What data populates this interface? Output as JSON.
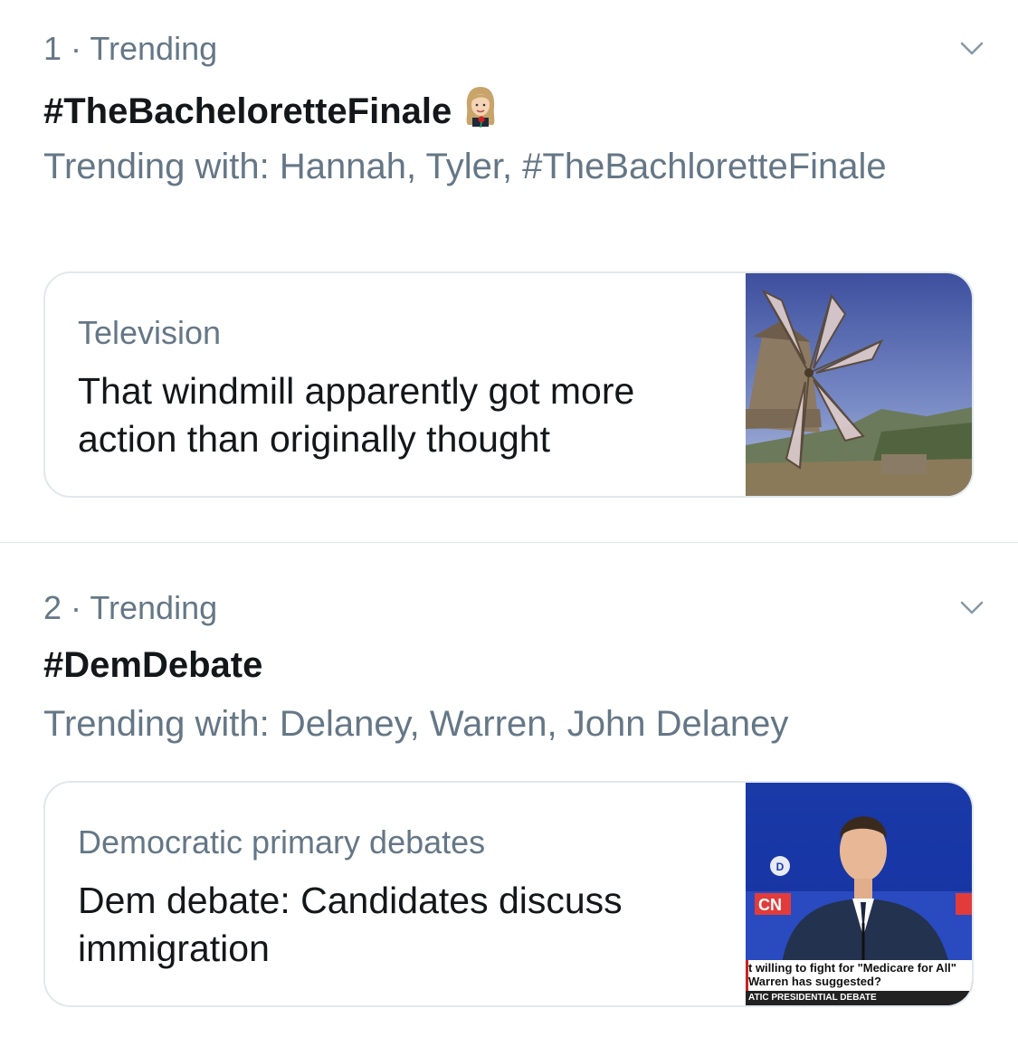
{
  "trends": [
    {
      "rank_label": "1 · Trending",
      "hashtag": "#TheBacheloretteFinale",
      "trending_with": "Trending with: Hannah, Tyler, #TheBachloretteFinale",
      "card": {
        "category": "Television",
        "headline": "That windmill apparently got more action than originally thought",
        "thumbnail": "windmill-photo"
      },
      "emoji": "hashtag-emoji-woman-with-rose",
      "chevron": "chevron-down-icon"
    },
    {
      "rank_label": "2 · Trending",
      "hashtag": "#DemDebate",
      "trending_with": "Trending with: Delaney, Warren, John Delaney",
      "card": {
        "category": "Democratic primary debates",
        "headline": "Dem debate: Candidates discuss immigration",
        "thumbnail": "debate-photo",
        "thumb_lines": [
          "t willing to fight for \"Medicare for All\"",
          "Warren has suggested?",
          "ATIC PRESIDENTIAL DEBATE"
        ]
      },
      "chevron": "chevron-down-icon"
    }
  ],
  "colors": {
    "primary_text": "#14171a",
    "secondary_text": "#657786",
    "border": "#e1e8ed",
    "chevron": "#8899a6"
  }
}
